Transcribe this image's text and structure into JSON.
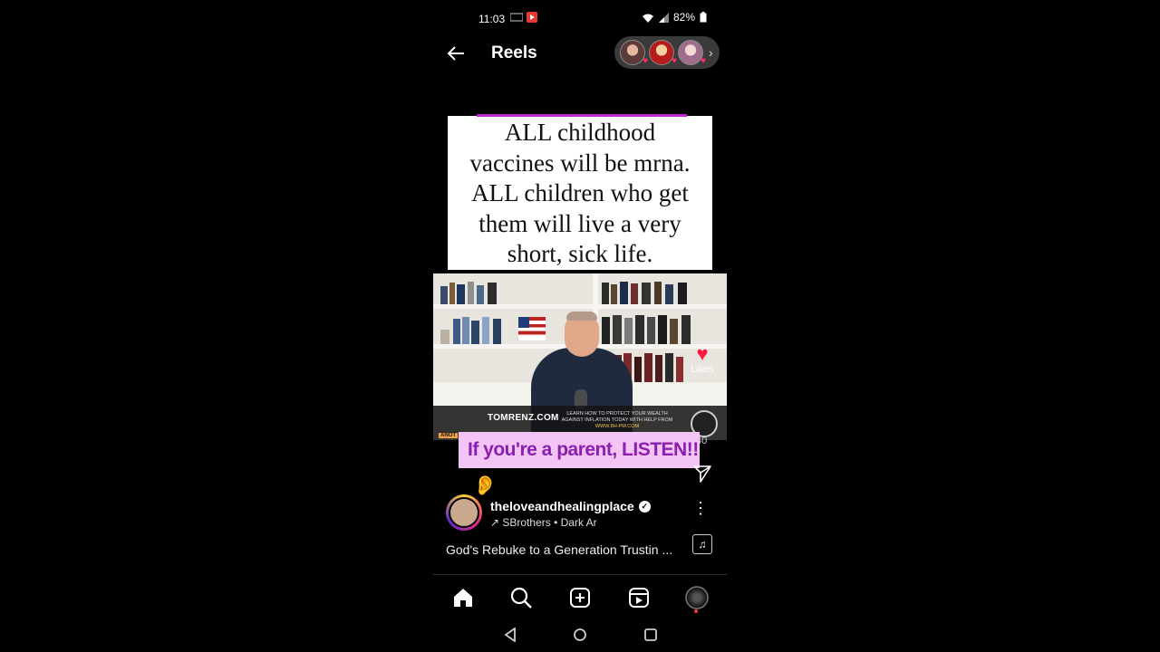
{
  "status_bar": {
    "time": "11:03",
    "battery": "82%"
  },
  "header": {
    "title": "Reels"
  },
  "stories": [
    "story-1",
    "story-2",
    "story-3"
  ],
  "reel": {
    "caption_lines": [
      "ALL childhood",
      "vaccines will be mrna.",
      "ALL children who get",
      "them will live a very",
      "short, sick life."
    ],
    "lower_third": {
      "site": "TOMRENZ.COM",
      "tagline_1": "LEARN HOW TO PROTECT YOUR WEALTH",
      "tagline_2": "AGAINST INFLATION TODAY WITH HELP FROM",
      "url": "WWW.8H-PM.COM",
      "badge": "ANOT"
    },
    "likes_label": "Likes",
    "likes_count": "40",
    "sticker_text": "If you're a parent, LISTEN!!",
    "sticker_emoji": "👂"
  },
  "post": {
    "username": "theloveandhealingplace",
    "audio": "SBrothers • Dark Ar",
    "description": "God's Rebuke to a Generation Trustin ..."
  },
  "colors": {
    "accent_pink": "#c026d3",
    "sticker_bg": "#f3c4f4",
    "sticker_text": "#8a1fb0",
    "like_red": "#ff1744"
  }
}
